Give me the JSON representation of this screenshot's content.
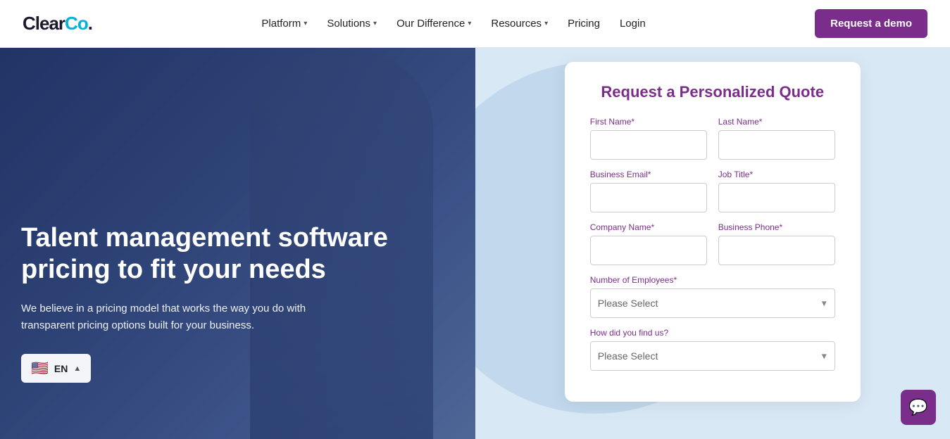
{
  "header": {
    "logo_clear": "Clear",
    "logo_co": "Co",
    "logo_dot": ".",
    "nav": [
      {
        "label": "Platform",
        "has_dropdown": true
      },
      {
        "label": "Solutions",
        "has_dropdown": true
      },
      {
        "label": "Our Difference",
        "has_dropdown": true
      },
      {
        "label": "Resources",
        "has_dropdown": true
      },
      {
        "label": "Pricing",
        "has_dropdown": false
      },
      {
        "label": "Login",
        "has_dropdown": false
      }
    ],
    "cta_label": "Request a demo"
  },
  "hero": {
    "title": "Talent management software pricing to fit your needs",
    "subtitle": "We believe in a pricing model that works the way you do with transparent pricing options built for your business.",
    "lang_code": "EN",
    "lang_chevron": "▲"
  },
  "form": {
    "title": "Request a Personalized Quote",
    "fields": [
      {
        "id": "first_name",
        "label": "First Name",
        "required": true,
        "type": "text",
        "placeholder": ""
      },
      {
        "id": "last_name",
        "label": "Last Name",
        "required": true,
        "type": "text",
        "placeholder": ""
      },
      {
        "id": "business_email",
        "label": "Business Email",
        "required": true,
        "type": "text",
        "placeholder": ""
      },
      {
        "id": "job_title",
        "label": "Job Title",
        "required": true,
        "type": "text",
        "placeholder": ""
      },
      {
        "id": "company_name",
        "label": "Company Name",
        "required": true,
        "type": "text",
        "placeholder": ""
      },
      {
        "id": "business_phone",
        "label": "Business Phone",
        "required": true,
        "type": "text",
        "placeholder": ""
      },
      {
        "id": "num_employees",
        "label": "Number of Employees",
        "required": true,
        "type": "select",
        "placeholder": "Please Select"
      },
      {
        "id": "how_find",
        "label": "How did you find us?",
        "required": false,
        "type": "select",
        "placeholder": "Please Select"
      }
    ]
  },
  "chat": {
    "icon": "💬"
  }
}
